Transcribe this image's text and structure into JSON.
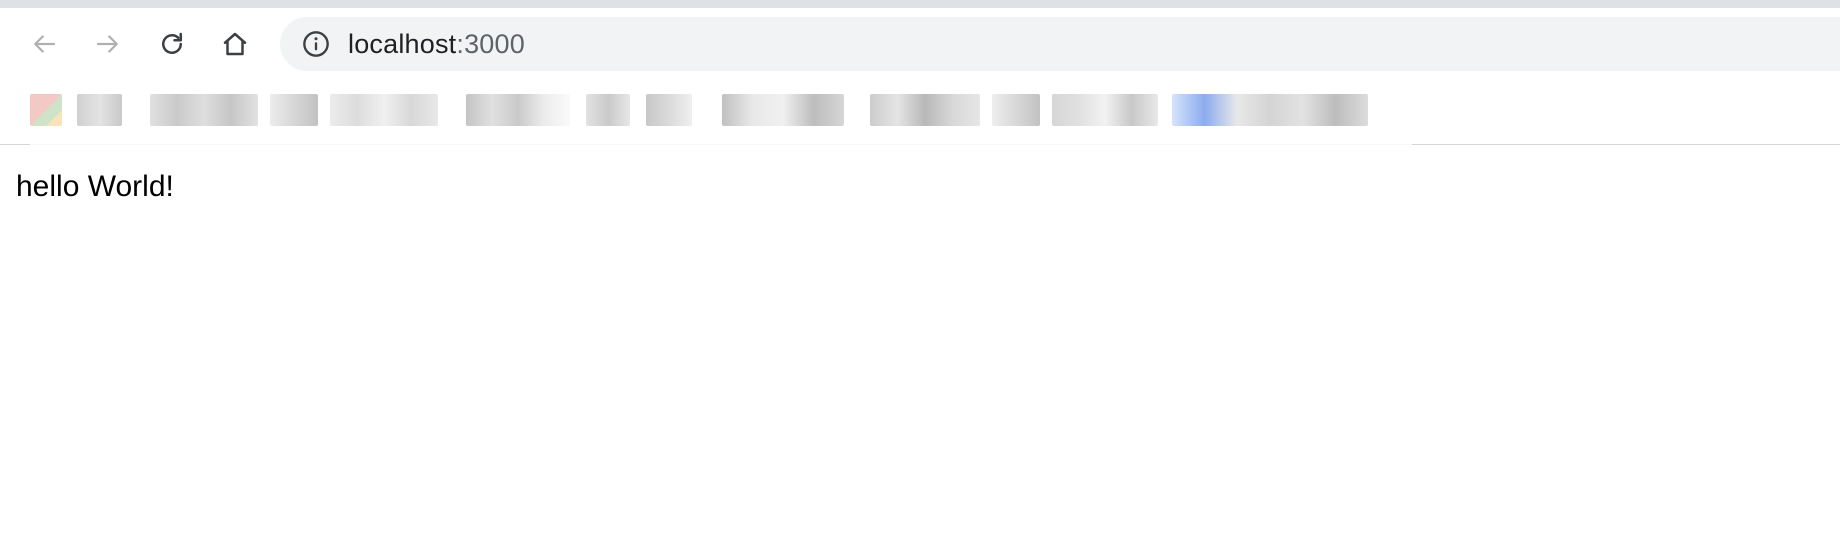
{
  "browser": {
    "toolbar": {
      "back_icon": "arrow-left-icon",
      "forward_icon": "arrow-right-icon",
      "reload_icon": "reload-icon",
      "home_icon": "home-icon"
    },
    "omnibox": {
      "security_icon": "info-icon",
      "host": "localhost",
      "port": ":3000"
    },
    "bookmarks": {
      "note": "",
      "items": [
        {
          "kind": "favicon-blurred"
        },
        {
          "kind": "label-blurred"
        },
        {
          "kind": "label-blurred"
        },
        {
          "kind": "label-blurred"
        },
        {
          "kind": "label-blurred"
        },
        {
          "kind": "label-blurred"
        },
        {
          "kind": "label-blurred"
        },
        {
          "kind": "label-blurred"
        },
        {
          "kind": "label-blurred"
        },
        {
          "kind": "label-blurred"
        },
        {
          "kind": "label-blurred"
        },
        {
          "kind": "label-blurred"
        },
        {
          "kind": "label-blurred"
        }
      ]
    }
  },
  "page": {
    "text": "hello World!"
  },
  "colors": {
    "tab_strip": "#dee1e6",
    "omnibox_bg": "#f1f3f4",
    "icon_disabled": "#b0b0b0",
    "icon_active": "#3c4043",
    "text": "#000000"
  }
}
